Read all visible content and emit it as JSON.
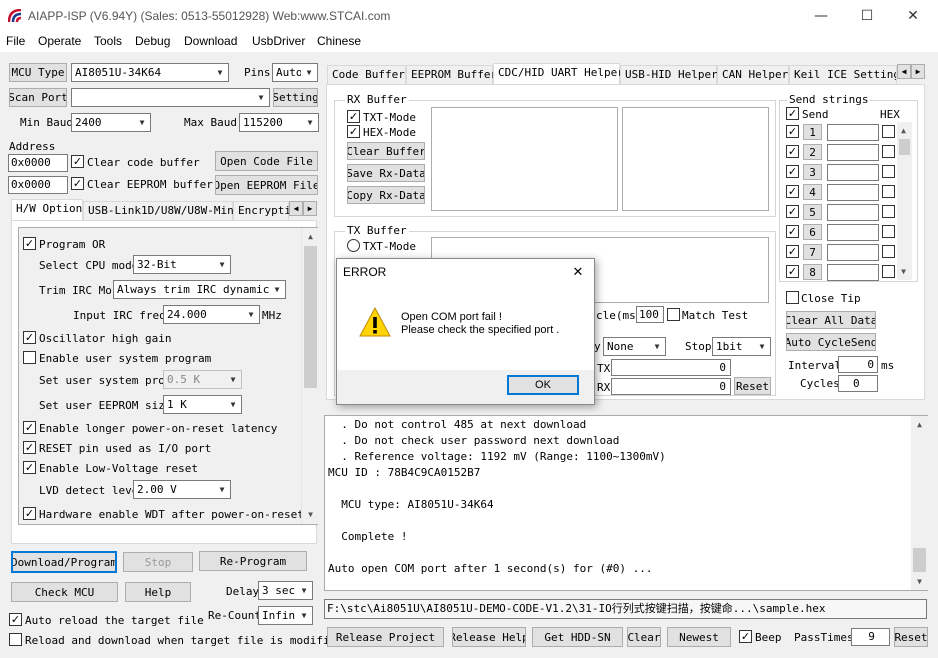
{
  "window": {
    "title": "AIAPP-ISP (V6.94Y) (Sales: 0513-55012928) Web:www.STCAI.com"
  },
  "menu": [
    "File",
    "Operate",
    "Tools",
    "Debug",
    "Download",
    "UsbDriver",
    "Chinese"
  ],
  "left": {
    "mcu_type_label": "MCU Type",
    "mcu_type_value": "AI8051U-34K64",
    "pins_label": "Pins",
    "pins_value": "Auto",
    "scan_port_label": "Scan Port",
    "scan_port_value": "",
    "setting_label": "Setting",
    "min_baud_label": "Min Baud",
    "min_baud_value": "2400",
    "max_baud_label": "Max Baud",
    "max_baud_value": "115200",
    "address_label": "Address",
    "code_addr": "0x0000",
    "clear_code_label": "Clear code buffer",
    "open_code_file": "Open Code File",
    "eeprom_addr": "0x0000",
    "clear_eeprom_label": "Clear EEPROM buffer",
    "open_eeprom_file": "Open EEPROM File",
    "tabs": [
      "H/W Option",
      "USB-Link1D/U8W/U8W-Mini",
      "Encrypti"
    ],
    "hw": {
      "program_or": "Program OR",
      "select_cpu_mode_label": "Select CPU mode",
      "select_cpu_mode_value": "32-Bit",
      "trim_irc_label": "Trim IRC Mo",
      "trim_irc_value": "Always trim IRC dynamical:",
      "input_irc_label": "Input IRC frequency",
      "input_irc_value": "24.000",
      "input_irc_unit": "MHz",
      "osc_high_gain": "Oscillator high gain",
      "enable_user_sys": "Enable user system program",
      "set_user_sys_label": "Set user system prog",
      "set_user_sys_value": "0.5 K",
      "set_user_eeprom_label": "Set user EEPROM size",
      "set_user_eeprom_value": "1   K",
      "enable_longer": "Enable longer power-on-reset latency",
      "reset_pin": "RESET pin used as I/O port",
      "enable_lvr": "Enable Low-Voltage reset",
      "lvd_label": "LVD detect leve",
      "lvd_value": "2.00 V",
      "hw_wdt": "Hardware enable WDT after power-on-reset"
    },
    "download_program": "Download/Program",
    "stop": "Stop",
    "re_program": "Re-Program",
    "check_mcu": "Check MCU",
    "help": "Help",
    "delay_label": "Delay",
    "delay_value": "3 sec:",
    "re_count_label": "Re-Count",
    "re_count_value": "Infin",
    "auto_reload": "Auto reload the target file",
    "reload_download": "Reload and download when target file is modified"
  },
  "right": {
    "tabs": [
      "Code Buffer",
      "EEPROM Buffer",
      "CDC/HID UART Helper",
      "USB-HID Helper",
      "CAN Helper",
      "Keil ICE Settings"
    ],
    "rx_buffer": "RX Buffer",
    "txt_mode": "TXT-Mode",
    "hex_mode": "HEX-Mode",
    "clear_buffer": "Clear Buffer",
    "save_rx": "Save Rx-Data",
    "copy_rx": "Copy Rx-Data",
    "tx_buffer": "TX Buffer",
    "tx_txt_mode": "TXT-Mode",
    "cycle_label": "cle(ms)",
    "cycle_value": "100",
    "match_test": "Match Test",
    "parity_label": "y",
    "parity_value": "None",
    "stop_label": "Stop",
    "stop_value": "1bit",
    "tx_label": "TX",
    "tx_value": "0",
    "rx_label": "RX",
    "rx_value": "0",
    "reset": "Reset",
    "send_strings": "Send strings",
    "send_label": "Send",
    "hex_label": "HEX",
    "send_rows": [
      "1",
      "2",
      "3",
      "4",
      "5",
      "6",
      "7",
      "8"
    ],
    "close_tip": "Close Tip",
    "clear_all": "Clear All Data",
    "auto_cycle": "Auto CycleSend",
    "interval_label": "Interval",
    "interval_value": "0",
    "interval_unit": "ms",
    "cycles_label": "Cycles",
    "cycles_value": "0"
  },
  "log": [
    "  . Do not control 485 at next download",
    "  . Do not check user password next download",
    "  . Reference voltage: 1192 mV (Range: 1100~1300mV)",
    "MCU ID : 78B4C9CA0152B7",
    "",
    "  MCU type: AI8051U-34K64",
    "",
    "  Complete !",
    "",
    "Auto open COM port after 1 second(s) for (#0) ..."
  ],
  "file_path": "F:\\stc\\Ai8051U\\AI8051U-DEMO-CODE-V1.2\\31-IO行列式按键扫描，按键命...\\sample.hex",
  "bottom": {
    "release_project": "Release Project",
    "release_help": "Release Help",
    "get_hdd_sn": "Get HDD-SN",
    "clear": "Clear",
    "newest": "Newest",
    "beep": "Beep",
    "pass_times_label": "PassTimes",
    "pass_times_value": "9",
    "reset": "Reset"
  },
  "dialog": {
    "title": "ERROR",
    "line1": "Open COM port fail !",
    "line2": "Please check the specified port .",
    "ok": "OK"
  }
}
